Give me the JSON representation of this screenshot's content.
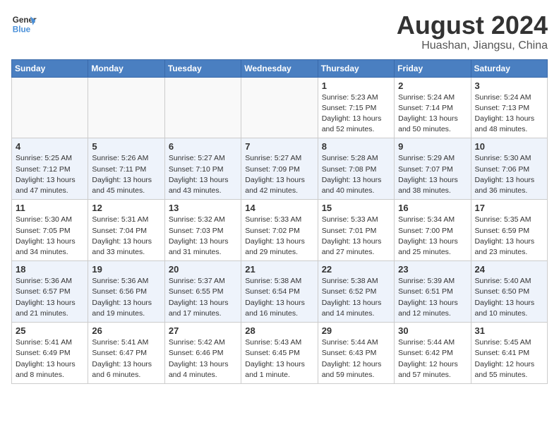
{
  "header": {
    "logo_line1": "General",
    "logo_line2": "Blue",
    "month": "August 2024",
    "location": "Huashan, Jiangsu, China"
  },
  "weekdays": [
    "Sunday",
    "Monday",
    "Tuesday",
    "Wednesday",
    "Thursday",
    "Friday",
    "Saturday"
  ],
  "weeks": [
    [
      {
        "day": "",
        "info": ""
      },
      {
        "day": "",
        "info": ""
      },
      {
        "day": "",
        "info": ""
      },
      {
        "day": "",
        "info": ""
      },
      {
        "day": "1",
        "info": "Sunrise: 5:23 AM\nSunset: 7:15 PM\nDaylight: 13 hours\nand 52 minutes."
      },
      {
        "day": "2",
        "info": "Sunrise: 5:24 AM\nSunset: 7:14 PM\nDaylight: 13 hours\nand 50 minutes."
      },
      {
        "day": "3",
        "info": "Sunrise: 5:24 AM\nSunset: 7:13 PM\nDaylight: 13 hours\nand 48 minutes."
      }
    ],
    [
      {
        "day": "4",
        "info": "Sunrise: 5:25 AM\nSunset: 7:12 PM\nDaylight: 13 hours\nand 47 minutes."
      },
      {
        "day": "5",
        "info": "Sunrise: 5:26 AM\nSunset: 7:11 PM\nDaylight: 13 hours\nand 45 minutes."
      },
      {
        "day": "6",
        "info": "Sunrise: 5:27 AM\nSunset: 7:10 PM\nDaylight: 13 hours\nand 43 minutes."
      },
      {
        "day": "7",
        "info": "Sunrise: 5:27 AM\nSunset: 7:09 PM\nDaylight: 13 hours\nand 42 minutes."
      },
      {
        "day": "8",
        "info": "Sunrise: 5:28 AM\nSunset: 7:08 PM\nDaylight: 13 hours\nand 40 minutes."
      },
      {
        "day": "9",
        "info": "Sunrise: 5:29 AM\nSunset: 7:07 PM\nDaylight: 13 hours\nand 38 minutes."
      },
      {
        "day": "10",
        "info": "Sunrise: 5:30 AM\nSunset: 7:06 PM\nDaylight: 13 hours\nand 36 minutes."
      }
    ],
    [
      {
        "day": "11",
        "info": "Sunrise: 5:30 AM\nSunset: 7:05 PM\nDaylight: 13 hours\nand 34 minutes."
      },
      {
        "day": "12",
        "info": "Sunrise: 5:31 AM\nSunset: 7:04 PM\nDaylight: 13 hours\nand 33 minutes."
      },
      {
        "day": "13",
        "info": "Sunrise: 5:32 AM\nSunset: 7:03 PM\nDaylight: 13 hours\nand 31 minutes."
      },
      {
        "day": "14",
        "info": "Sunrise: 5:33 AM\nSunset: 7:02 PM\nDaylight: 13 hours\nand 29 minutes."
      },
      {
        "day": "15",
        "info": "Sunrise: 5:33 AM\nSunset: 7:01 PM\nDaylight: 13 hours\nand 27 minutes."
      },
      {
        "day": "16",
        "info": "Sunrise: 5:34 AM\nSunset: 7:00 PM\nDaylight: 13 hours\nand 25 minutes."
      },
      {
        "day": "17",
        "info": "Sunrise: 5:35 AM\nSunset: 6:59 PM\nDaylight: 13 hours\nand 23 minutes."
      }
    ],
    [
      {
        "day": "18",
        "info": "Sunrise: 5:36 AM\nSunset: 6:57 PM\nDaylight: 13 hours\nand 21 minutes."
      },
      {
        "day": "19",
        "info": "Sunrise: 5:36 AM\nSunset: 6:56 PM\nDaylight: 13 hours\nand 19 minutes."
      },
      {
        "day": "20",
        "info": "Sunrise: 5:37 AM\nSunset: 6:55 PM\nDaylight: 13 hours\nand 17 minutes."
      },
      {
        "day": "21",
        "info": "Sunrise: 5:38 AM\nSunset: 6:54 PM\nDaylight: 13 hours\nand 16 minutes."
      },
      {
        "day": "22",
        "info": "Sunrise: 5:38 AM\nSunset: 6:52 PM\nDaylight: 13 hours\nand 14 minutes."
      },
      {
        "day": "23",
        "info": "Sunrise: 5:39 AM\nSunset: 6:51 PM\nDaylight: 13 hours\nand 12 minutes."
      },
      {
        "day": "24",
        "info": "Sunrise: 5:40 AM\nSunset: 6:50 PM\nDaylight: 13 hours\nand 10 minutes."
      }
    ],
    [
      {
        "day": "25",
        "info": "Sunrise: 5:41 AM\nSunset: 6:49 PM\nDaylight: 13 hours\nand 8 minutes."
      },
      {
        "day": "26",
        "info": "Sunrise: 5:41 AM\nSunset: 6:47 PM\nDaylight: 13 hours\nand 6 minutes."
      },
      {
        "day": "27",
        "info": "Sunrise: 5:42 AM\nSunset: 6:46 PM\nDaylight: 13 hours\nand 4 minutes."
      },
      {
        "day": "28",
        "info": "Sunrise: 5:43 AM\nSunset: 6:45 PM\nDaylight: 13 hours\nand 1 minute."
      },
      {
        "day": "29",
        "info": "Sunrise: 5:44 AM\nSunset: 6:43 PM\nDaylight: 12 hours\nand 59 minutes."
      },
      {
        "day": "30",
        "info": "Sunrise: 5:44 AM\nSunset: 6:42 PM\nDaylight: 12 hours\nand 57 minutes."
      },
      {
        "day": "31",
        "info": "Sunrise: 5:45 AM\nSunset: 6:41 PM\nDaylight: 12 hours\nand 55 minutes."
      }
    ]
  ]
}
